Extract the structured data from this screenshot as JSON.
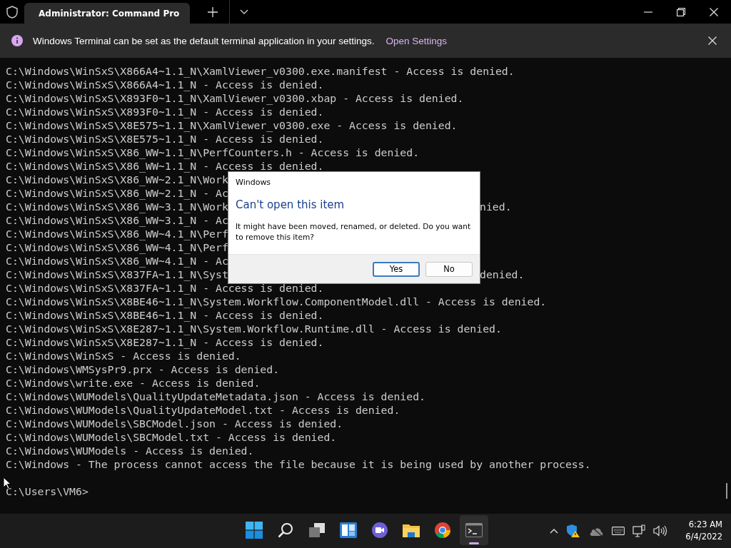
{
  "titlebar": {
    "tabs": [
      {
        "title": "Administrator: Command Pro",
        "selected": true
      }
    ]
  },
  "infobar": {
    "message": "Windows Terminal can be set as the default terminal application in your settings.",
    "link": "Open Settings"
  },
  "terminal": {
    "lines": [
      {
        "kind": "full",
        "text": "C:\\Windows\\WinSxS\\X866A4~1.1_N\\XamlViewer_v0300.exe.manifest - Access is denied."
      },
      {
        "kind": "full",
        "text": "C:\\Windows\\WinSxS\\X866A4~1.1_N - Access is denied."
      },
      {
        "kind": "full",
        "text": "C:\\Windows\\WinSxS\\X893F0~1.1_N\\XamlViewer_v0300.xbap - Access is denied."
      },
      {
        "kind": "full",
        "text": "C:\\Windows\\WinSxS\\X893F0~1.1_N - Access is denied."
      },
      {
        "kind": "full",
        "text": "C:\\Windows\\WinSxS\\X8E575~1.1_N\\XamlViewer_v0300.exe - Access is denied."
      },
      {
        "kind": "full",
        "text": "C:\\Windows\\WinSxS\\X8E575~1.1_N - Access is denied."
      },
      {
        "kind": "full",
        "text": "C:\\Windows\\WinSxS\\X86_WW~1.1_N\\PerfCounters.h - Access is denied."
      },
      {
        "kind": "full",
        "text": "C:\\Windows\\WinSxS\\X86_WW~1.1_N - Access is denied."
      },
      {
        "kind": "split",
        "left": "C:\\Windows\\WinSxS\\X86_WW~2.1_N\\Work"
      },
      {
        "kind": "split",
        "left": "C:\\Windows\\WinSxS\\X86_WW~2.1_N - Ac"
      },
      {
        "kind": "split",
        "left": "C:\\Windows\\WinSxS\\X86_WW~3.1_N\\Work",
        "right": "nied."
      },
      {
        "kind": "split",
        "left": "C:\\Windows\\WinSxS\\X86_WW~3.1_N - Ac"
      },
      {
        "kind": "split",
        "left": "C:\\Windows\\WinSxS\\X86_WW~4.1_N\\Perf"
      },
      {
        "kind": "split",
        "left": "C:\\Windows\\WinSxS\\X86_WW~4.1_N\\Perf"
      },
      {
        "kind": "split",
        "left": "C:\\Windows\\WinSxS\\X86_WW~4.1_N - Ac"
      },
      {
        "kind": "split",
        "left": "C:\\Windows\\WinSxS\\X837FA~1.1_N\\Syst",
        "right": "denied."
      },
      {
        "kind": "full",
        "text": "C:\\Windows\\WinSxS\\X837FA~1.1_N - Access is denied."
      },
      {
        "kind": "full",
        "text": "C:\\Windows\\WinSxS\\X8BE46~1.1_N\\System.Workflow.ComponentModel.dll - Access is denied."
      },
      {
        "kind": "full",
        "text": "C:\\Windows\\WinSxS\\X8BE46~1.1_N - Access is denied."
      },
      {
        "kind": "full",
        "text": "C:\\Windows\\WinSxS\\X8E287~1.1_N\\System.Workflow.Runtime.dll - Access is denied."
      },
      {
        "kind": "full",
        "text": "C:\\Windows\\WinSxS\\X8E287~1.1_N - Access is denied."
      },
      {
        "kind": "full",
        "text": "C:\\Windows\\WinSxS - Access is denied."
      },
      {
        "kind": "full",
        "text": "C:\\Windows\\WMSysPr9.prx - Access is denied."
      },
      {
        "kind": "full",
        "text": "C:\\Windows\\write.exe - Access is denied."
      },
      {
        "kind": "full",
        "text": "C:\\Windows\\WUModels\\QualityUpdateMetadata.json - Access is denied."
      },
      {
        "kind": "full",
        "text": "C:\\Windows\\WUModels\\QualityUpdateModel.txt - Access is denied."
      },
      {
        "kind": "full",
        "text": "C:\\Windows\\WUModels\\SBCModel.json - Access is denied."
      },
      {
        "kind": "full",
        "text": "C:\\Windows\\WUModels\\SBCModel.txt - Access is denied."
      },
      {
        "kind": "full",
        "text": "C:\\Windows\\WUModels - Access is denied."
      },
      {
        "kind": "full",
        "text": "C:\\Windows - The process cannot access the file because it is being used by another process."
      },
      {
        "kind": "blank"
      },
      {
        "kind": "full",
        "text": "C:\\Users\\VM6>"
      }
    ]
  },
  "dialog": {
    "title": "Windows",
    "heading": "Can't open this item",
    "message": "It might have been moved, renamed, or deleted. Do you want to remove this item?",
    "buttons": [
      {
        "label": "Yes",
        "default": true
      },
      {
        "label": "No",
        "default": false
      }
    ]
  },
  "taskbar": {
    "apps": [
      {
        "kind": "start",
        "selected": false
      },
      {
        "kind": "search",
        "selected": false
      },
      {
        "kind": "taskview",
        "selected": false
      },
      {
        "kind": "widgets",
        "selected": false
      },
      {
        "kind": "chat",
        "selected": false
      },
      {
        "kind": "explorer",
        "selected": false
      },
      {
        "kind": "browser",
        "selected": false
      },
      {
        "kind": "terminal",
        "selected": true
      }
    ],
    "time": "6:23 AM",
    "date": "6/4/2022"
  }
}
